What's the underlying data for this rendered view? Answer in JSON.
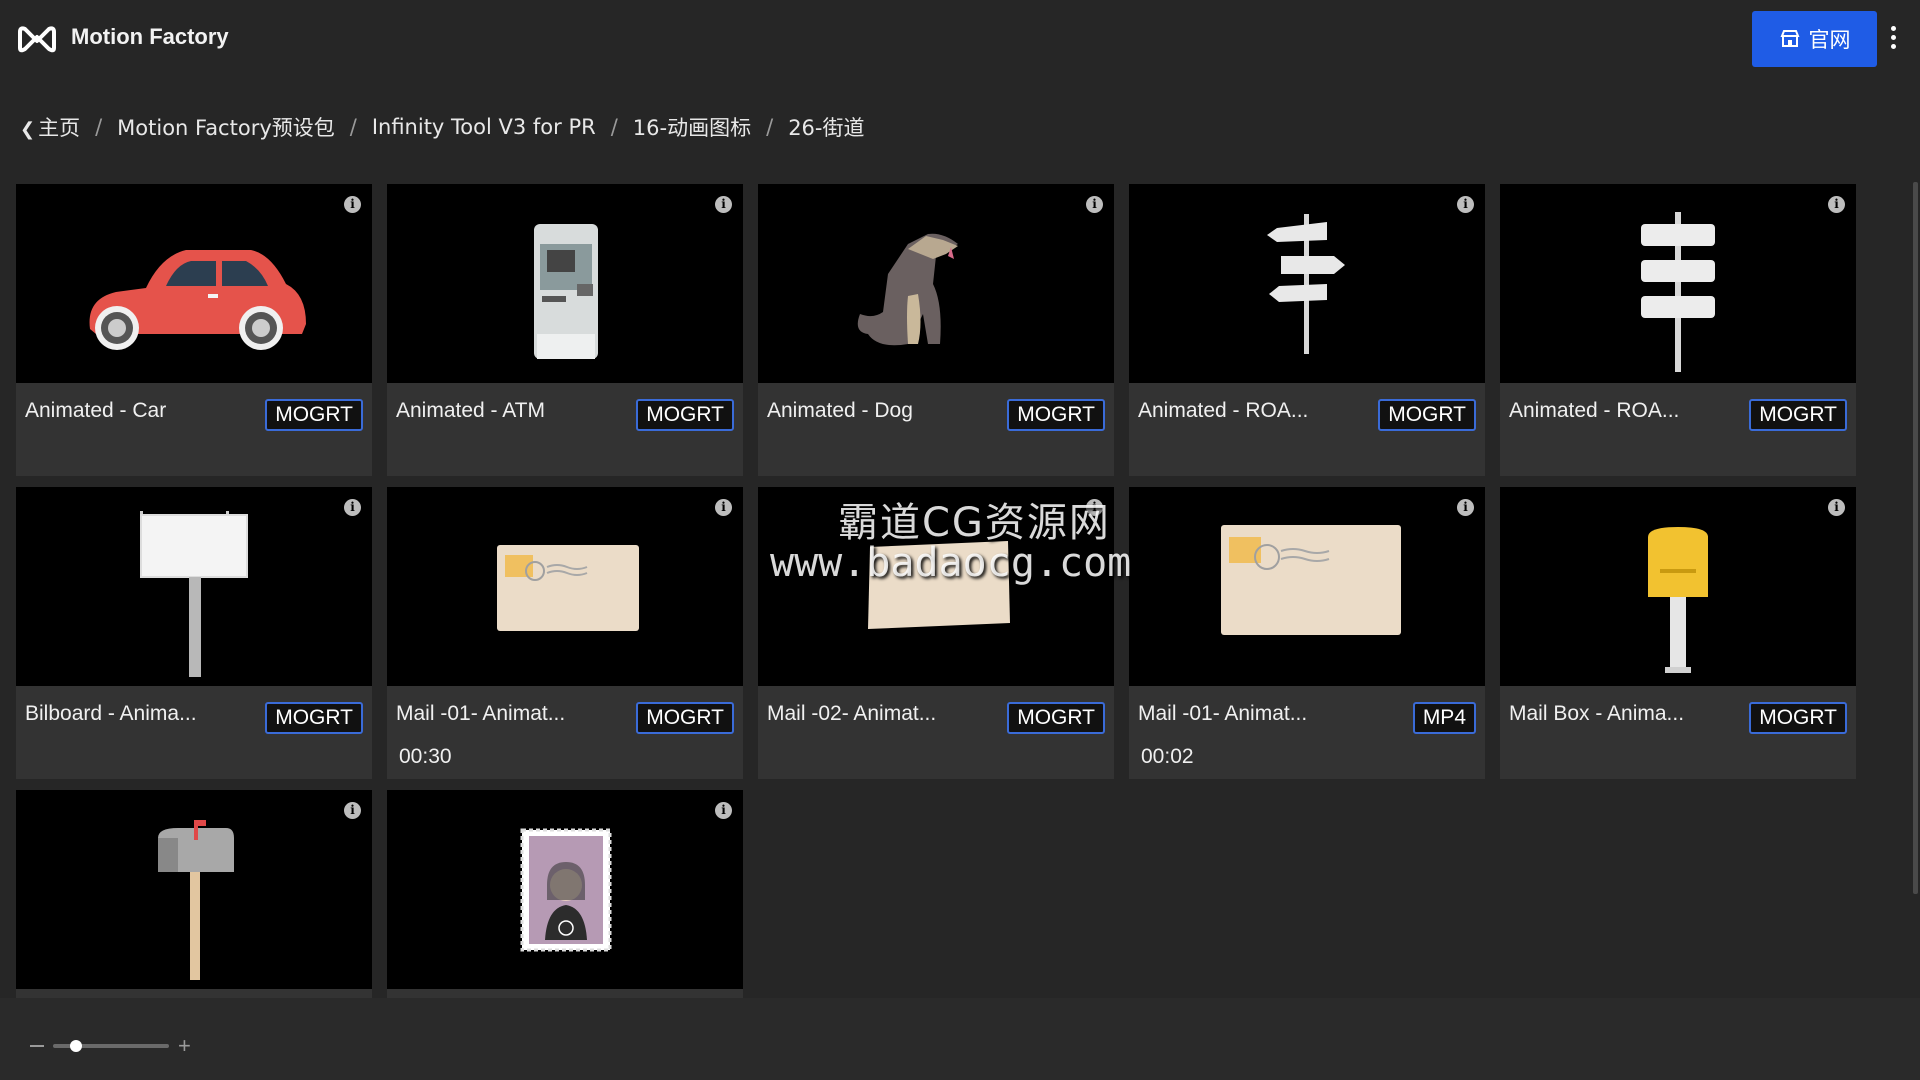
{
  "app": {
    "title": "Motion Factory",
    "site_button": "官网"
  },
  "breadcrumb": [
    "主页",
    "Motion Factory预设包",
    "Infinity Tool V3 for PR",
    "16-动画图标",
    "26-街道"
  ],
  "cards": [
    {
      "title": "Animated - Car",
      "badge": "MOGRT",
      "duration": "",
      "thumb": "car"
    },
    {
      "title": "Animated - ATM",
      "badge": "MOGRT",
      "duration": "",
      "thumb": "atm"
    },
    {
      "title": "Animated - Dog",
      "badge": "MOGRT",
      "duration": "",
      "thumb": "dog"
    },
    {
      "title": "Animated - ROA...",
      "badge": "MOGRT",
      "duration": "",
      "thumb": "signpost-arrows"
    },
    {
      "title": "Animated - ROA...",
      "badge": "MOGRT",
      "duration": "",
      "thumb": "signpost-boards"
    },
    {
      "title": "Bilboard - Anima...",
      "badge": "MOGRT",
      "duration": "",
      "thumb": "billboard"
    },
    {
      "title": "Mail -01- Animat...",
      "badge": "MOGRT",
      "duration": "00:30",
      "thumb": "envelope"
    },
    {
      "title": "Mail -02- Animat...",
      "badge": "MOGRT",
      "duration": "",
      "thumb": "envelope-tilted"
    },
    {
      "title": "Mail -01- Animat...",
      "badge": "MP4",
      "duration": "00:02",
      "thumb": "envelope-large"
    },
    {
      "title": "Mail Box - Anima...",
      "badge": "MOGRT",
      "duration": "",
      "thumb": "mailbox-yellow"
    },
    {
      "title": "",
      "badge": "",
      "duration": "",
      "thumb": "mailbox-grey"
    },
    {
      "title": "",
      "badge": "",
      "duration": "",
      "thumb": "stamp"
    }
  ],
  "watermark": {
    "line1": "霸道CG资源网",
    "line2": "www.badaocg.com"
  },
  "zoom": {
    "level": 0.2
  },
  "colors": {
    "accent": "#1f5ce6",
    "badge_border": "#3a6bd8",
    "background": "#262626",
    "card": "#333333"
  }
}
